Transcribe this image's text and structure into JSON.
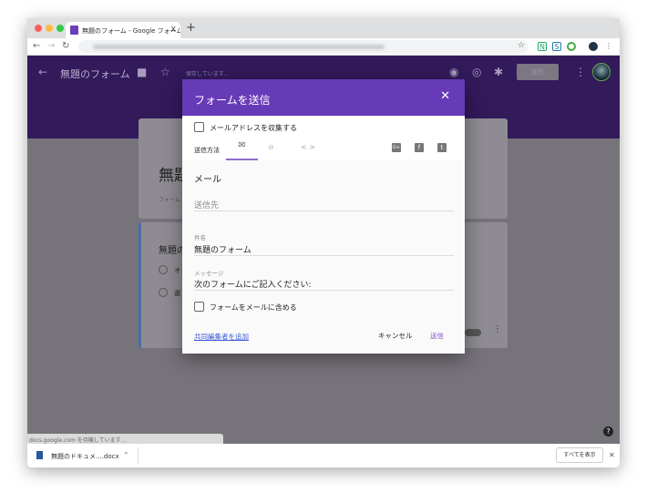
{
  "browser": {
    "tab_title": "無題のフォーム - Google フォーム",
    "new_tab": "+",
    "close_tab": "X"
  },
  "app": {
    "title": "無題のフォーム",
    "saving_status": "保存しています...",
    "send_label": "送信"
  },
  "background_form": {
    "title": "無題",
    "description": "フォーム",
    "question": "無題の",
    "option1": "オ",
    "option2": "選"
  },
  "dialog": {
    "title": "フォームを送信",
    "collect_email": "メールアドレスを収集する",
    "send_method_label": "送信方法",
    "section_title": "メール",
    "to_placeholder": "送信先",
    "subject_label": "件名",
    "subject_value": "無題のフォーム",
    "message_label": "メッセージ",
    "message_value": "次のフォームにご記入ください:",
    "include_form": "フォームをメールに含める",
    "add_collaborators": "共同編集者を追加",
    "cancel": "キャンセル",
    "send": "送信",
    "accent": "#673ab7"
  },
  "status_bar": "docs.google.com を待機しています...",
  "downloads": {
    "file": "無題のドキュメ....docx",
    "show_all": "すべてを表示"
  }
}
